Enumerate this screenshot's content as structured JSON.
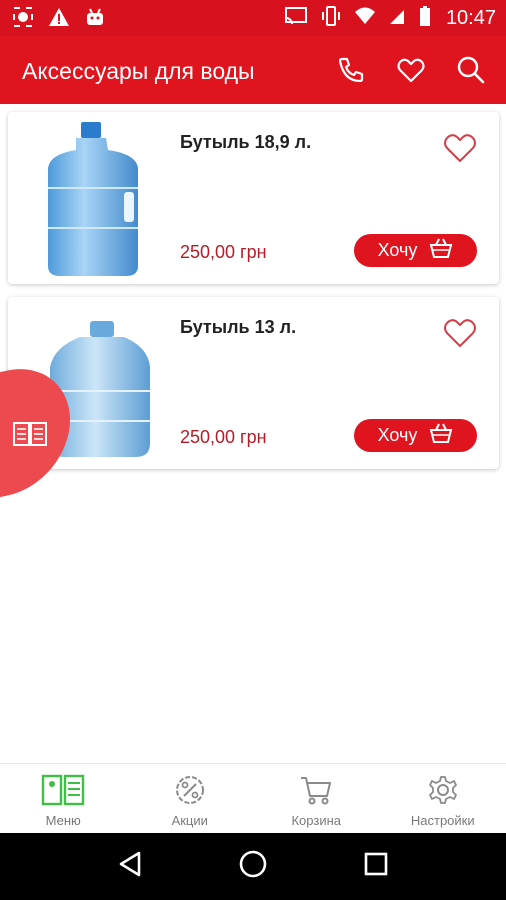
{
  "statusbar": {
    "time": "10:47"
  },
  "appbar": {
    "title": "Аксессуары для воды",
    "icons": [
      "phone-icon",
      "heart-icon",
      "search-icon"
    ]
  },
  "products": [
    {
      "name": "Бутыль 18,9 л.",
      "price": "250,00 грн",
      "button": "Хочу"
    },
    {
      "name": "Бутыль 13 л.",
      "price": "250,00 грн",
      "button": "Хочу"
    }
  ],
  "bottomnav": {
    "items": [
      {
        "label": "Меню",
        "icon": "menu-book-icon",
        "active": true
      },
      {
        "label": "Акции",
        "icon": "percent-badge-icon"
      },
      {
        "label": "Корзина",
        "icon": "cart-icon"
      },
      {
        "label": "Настройки",
        "icon": "gear-icon"
      }
    ]
  },
  "colors": {
    "brand_red": "#e0141f",
    "accent_green": "#3fbf46",
    "price_red": "#b51c27"
  }
}
